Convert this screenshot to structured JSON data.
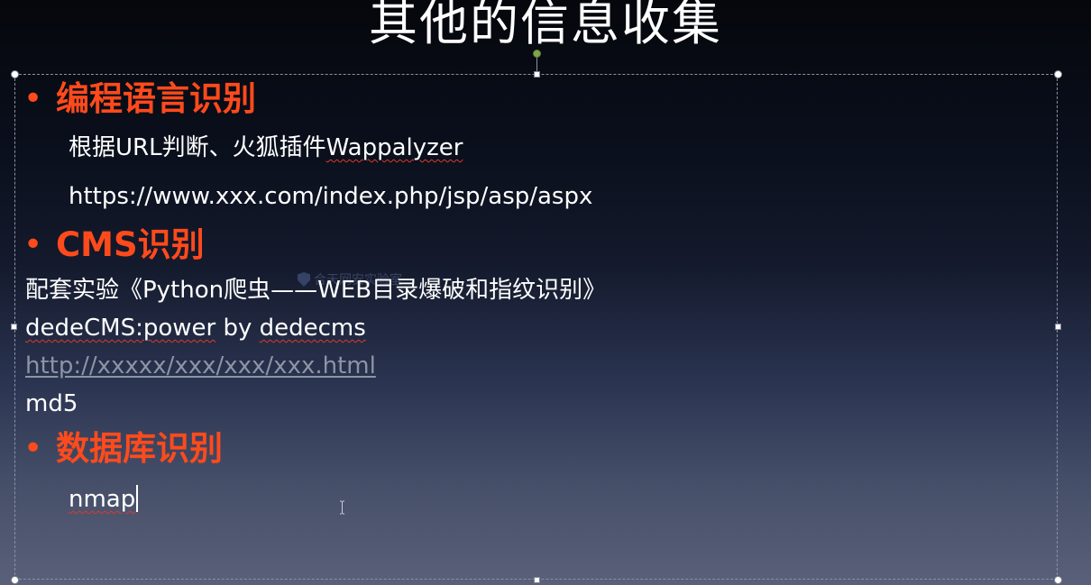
{
  "slide": {
    "title": "其他的信息收集",
    "sections": [
      {
        "heading": "编程语言识别",
        "lines": [
          "根据URL判断、火狐插件Wappalyzer",
          "https://www.xxx.com/index.php/jsp/asp/aspx"
        ]
      },
      {
        "heading": "CMS识别",
        "lines": [
          "配套实验《Python爬虫——WEB目录爆破和指纹识别》",
          "dedeCMS:power by dedecms",
          "http://xxxxx/xxx/xxx/xxx.html",
          "md5"
        ]
      },
      {
        "heading": "数据库识别",
        "lines": [
          "nmap"
        ]
      }
    ],
    "bullet_char": "•",
    "watermark": "合天网安实验室"
  },
  "colors": {
    "heading": "#ff4a1c",
    "text": "#ffffff",
    "link": "#8d94a4",
    "spellcheck": "#e0392b"
  }
}
